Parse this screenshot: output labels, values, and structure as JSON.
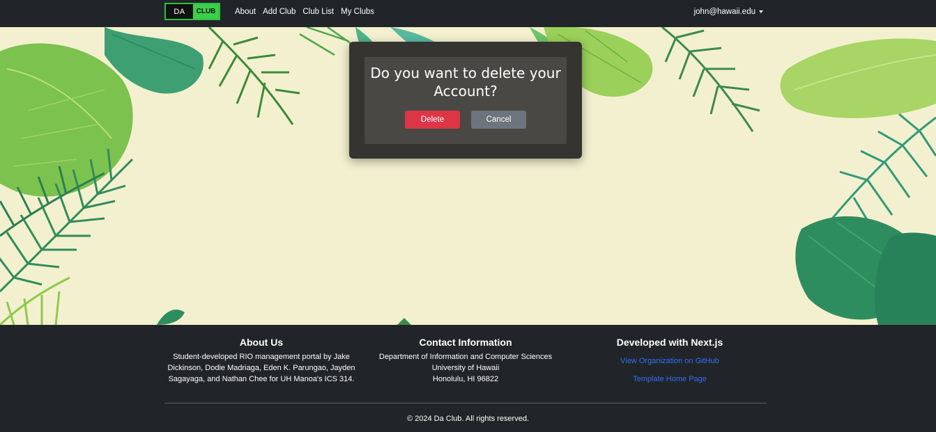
{
  "navbar": {
    "brand": {
      "left": "DA",
      "right": "CLUB"
    },
    "links": [
      "About",
      "Add Club",
      "Club List",
      "My Clubs"
    ],
    "user_email": "john@hawaii.edu"
  },
  "modal": {
    "title": "Do you want to delete your Account?",
    "delete_label": "Delete",
    "cancel_label": "Cancel"
  },
  "footer": {
    "about": {
      "heading": "About Us",
      "text": "Student-developed RIO management portal by Jake Dickinson, Dodie Madriaga, Eden K. Parungao, Jayden Sagayaga, and Nathan Chee for UH Manoa's ICS 314."
    },
    "contact": {
      "heading": "Contact Information",
      "lines": [
        "Department of Information and Computer Sciences",
        "University of Hawaii",
        "Honolulu, HI 96822"
      ]
    },
    "developed": {
      "heading": "Developed with Next.js",
      "links": [
        "View Organization on GitHub",
        "Template Home Page"
      ]
    },
    "copyright": "© 2024 Da Club. All rights reserved."
  },
  "colors": {
    "navbar_bg": "#212529",
    "hero_bg": "#f3f0cf",
    "delete": "#dc3545",
    "cancel": "#6c757d",
    "link": "#2f6ff5",
    "brand_green": "#3bd04b"
  }
}
